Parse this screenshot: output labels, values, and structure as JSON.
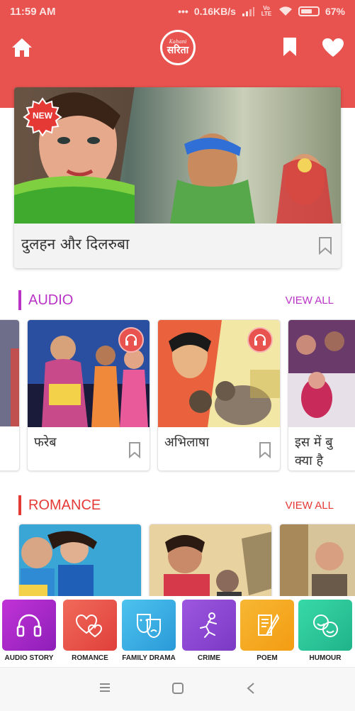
{
  "status": {
    "time": "11:59 AM",
    "dots": "•••",
    "network_speed": "0.16KB/s",
    "volte": "Vo LTE",
    "battery": "67%",
    "battery_level": 0.67
  },
  "header": {
    "logo_line1": "Kahani",
    "logo_line2": "सरिता",
    "accent": "#e8534f",
    "icons": [
      "home-icon",
      "bookmark-icon",
      "heart-icon"
    ]
  },
  "featured": {
    "badge": "NEW",
    "title": "दुलहन और दिलरुबा",
    "icon": "bookmark-outline-icon"
  },
  "sections": {
    "audio": {
      "title": "AUDIO",
      "view_all": "VIEW ALL",
      "color": "#b933c7",
      "cards": [
        {
          "title": "फरेब"
        },
        {
          "title": "अभिलाषा"
        },
        {
          "title": "इस में बु",
          "title_line2": "क्या है"
        }
      ]
    },
    "romance": {
      "title": "ROMANCE",
      "view_all": "VIEW ALL",
      "color": "#e53935"
    }
  },
  "categories": [
    {
      "label": "AUDIO STORY",
      "icon": "headphones-icon",
      "color": "#a020c6"
    },
    {
      "label": "ROMANCE",
      "icon": "hearts-icon",
      "color": "#e8534f"
    },
    {
      "label": "FAMILY DRAMA",
      "icon": "theater-masks-icon",
      "color": "#3fb4e8"
    },
    {
      "label": "CRIME",
      "icon": "crime-figure-icon",
      "color": "#8e44d6"
    },
    {
      "label": "POEM",
      "icon": "scroll-quill-icon",
      "color": "#f5a623"
    },
    {
      "label": "HUMOUR",
      "icon": "laughing-faces-icon",
      "color": "#2ec99a"
    }
  ],
  "navbar": {
    "icons": [
      "menu-icon",
      "home-square-icon",
      "back-icon"
    ]
  }
}
